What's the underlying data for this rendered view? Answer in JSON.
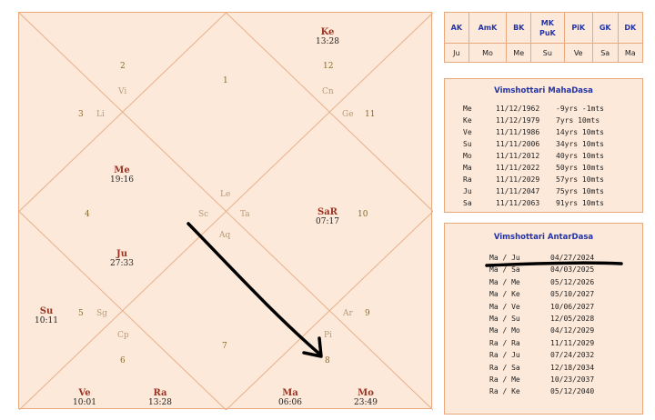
{
  "chart": {
    "house_numbers": [
      "1",
      "2",
      "3",
      "4",
      "5",
      "6",
      "7",
      "8",
      "9",
      "10",
      "11",
      "12"
    ],
    "signs": [
      "Vi",
      "Li",
      "Cn",
      "Ge",
      "Le",
      "Sc",
      "Ta",
      "Aq",
      "Sg",
      "Cp",
      "Ar",
      "Pi"
    ],
    "planets": [
      {
        "name": "Ke",
        "deg": "13:28"
      },
      {
        "name": "Me",
        "deg": "19:16"
      },
      {
        "name": "SaR",
        "deg": "07:17"
      },
      {
        "name": "Ju",
        "deg": "27:33"
      },
      {
        "name": "Su",
        "deg": "10:11"
      },
      {
        "name": "Ve",
        "deg": "10:01"
      },
      {
        "name": "Ra",
        "deg": "13:28"
      },
      {
        "name": "Ma",
        "deg": "06:06"
      },
      {
        "name": "Mo",
        "deg": "23:49"
      }
    ]
  },
  "karaka": {
    "headers": [
      "AK",
      "AmK",
      "BK",
      "MK PuK",
      "PiK",
      "GK",
      "DK"
    ],
    "headers_split": [
      [
        "AK"
      ],
      [
        "AmK"
      ],
      [
        "BK"
      ],
      [
        "MK",
        "PuK"
      ],
      [
        "PiK"
      ],
      [
        "GK"
      ],
      [
        "DK"
      ]
    ],
    "values": [
      "Ju",
      "Mo",
      "Me",
      "Su",
      "Ve",
      "Sa",
      "Ma"
    ]
  },
  "mahadasa": {
    "title": "Vimshottari MahaDasa",
    "rows": [
      {
        "planet": "Me",
        "date": "11/12/1962",
        "age": "-9yrs -1mts"
      },
      {
        "planet": "Ke",
        "date": "11/12/1979",
        "age": "7yrs 10mts"
      },
      {
        "planet": "Ve",
        "date": "11/11/1986",
        "age": "14yrs 10mts"
      },
      {
        "planet": "Su",
        "date": "11/11/2006",
        "age": "34yrs 10mts"
      },
      {
        "planet": "Mo",
        "date": "11/11/2012",
        "age": "40yrs 10mts"
      },
      {
        "planet": "Ma",
        "date": "11/11/2022",
        "age": "50yrs 10mts"
      },
      {
        "planet": "Ra",
        "date": "11/11/2029",
        "age": "57yrs 10mts"
      },
      {
        "planet": "Ju",
        "date": "11/11/2047",
        "age": "75yrs 10mts"
      },
      {
        "planet": "Sa",
        "date": "11/11/2063",
        "age": "91yrs 10mts"
      }
    ]
  },
  "antardasa": {
    "title": "Vimshottari AntarDasa",
    "rows": [
      {
        "period": "Ma / Ju",
        "date": "04/27/2024"
      },
      {
        "period": "Ma / Sa",
        "date": "04/03/2025"
      },
      {
        "period": "Ma / Me",
        "date": "05/12/2026"
      },
      {
        "period": "Ma / Ke",
        "date": "05/10/2027"
      },
      {
        "period": "Ma / Ve",
        "date": "10/06/2027"
      },
      {
        "period": "Ma / Su",
        "date": "12/05/2028"
      },
      {
        "period": "Ma / Mo",
        "date": "04/12/2029"
      },
      {
        "period": "Ra / Ra",
        "date": "11/11/2029"
      },
      {
        "period": "Ra / Ju",
        "date": "07/24/2032"
      },
      {
        "period": "Ra / Sa",
        "date": "12/18/2034"
      },
      {
        "period": "Ra / Me",
        "date": "10/23/2037"
      },
      {
        "period": "Ra / Ke",
        "date": "05/12/2040"
      }
    ]
  }
}
